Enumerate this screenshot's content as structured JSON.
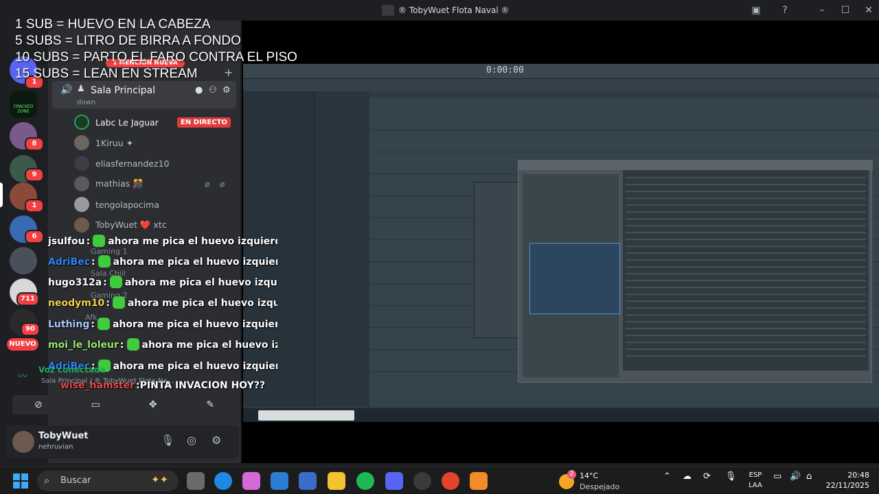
{
  "window": {
    "title": "® TobyWuet Flota Naval ®"
  },
  "overlay": {
    "lines": [
      "1 SUB = HUEVO EN LA CABEZA",
      "5 SUBS = LITRO DE BIRRA A FONDO",
      "10 SUBS = PARTO EL FARO CONTRA EL PISO",
      "15 SUBS = LEAN EN STREAM"
    ]
  },
  "rail": {
    "badges": [
      "1",
      "8",
      "9",
      "1",
      "6",
      "711",
      "90"
    ],
    "nuevo_label": "NUEVO",
    "cracked_label": "CRACKED ZONE"
  },
  "channels": {
    "mention_label": "1 MENCIÓN NUEVA",
    "voice_channel": {
      "name": "Sala Principal",
      "status": "down"
    },
    "members": [
      {
        "name": "Labc Le Jaguar",
        "live": true
      },
      {
        "name": "1Kiruu ✦"
      },
      {
        "name": "eliasfernandez10"
      },
      {
        "name": "mathias 🎊"
      },
      {
        "name": "tengolapocima"
      },
      {
        "name": "TobyWuet ❤️ xtc"
      }
    ],
    "live_label": "EN DIRECTO",
    "faded_channels": [
      "Gaming 1",
      "Sala Chill",
      "Gaming 2",
      "Afk"
    ]
  },
  "chat": {
    "messages": [
      {
        "user": "jsulfou",
        "color": "#ffffff",
        "text": "ahora me pica el huevo izquierdo c"
      },
      {
        "user": "AdriBec",
        "color": "#2f86f6",
        "text": "ahora me pica el huevo izquierdo"
      },
      {
        "user": "hugo312a",
        "color": "#ffffff",
        "text": "ahora me pica el huevo izquierd"
      },
      {
        "user": "neodym10",
        "color": "#f6d04d",
        "text": "ahora me pica el huevo izquierd"
      },
      {
        "user": "Luthing",
        "color": "#a8c8ff",
        "text": "ahora me pica el huevo izquierdo"
      },
      {
        "user": "moi_le_loleur",
        "color": "#9be870",
        "text": "ahora me pica el huevo izqui"
      },
      {
        "user": "AdriBec",
        "color": "#2f86f6",
        "text": "ahora me pica el huevo izquierdo"
      },
      {
        "user": "wise_hamster",
        "color": "#e04b4b",
        "text": "PINTA INVACION HOY??"
      }
    ]
  },
  "voice_panel": {
    "status": "Voz conectada",
    "location": "Sala Principal / ® TobyWuet Flota Na..."
  },
  "user": {
    "name": "TobyWuet",
    "tag": "nehruvian"
  },
  "daw": {
    "time": "0:00:00"
  },
  "taskbar": {
    "search_placeholder": "Buscar",
    "weather_temp": "14°C",
    "weather_condition": "Despejado",
    "weather_badge": "2",
    "lang_line1": "ESP",
    "lang_line2": "LAA",
    "time": "20:48",
    "date": "22/11/2025"
  }
}
